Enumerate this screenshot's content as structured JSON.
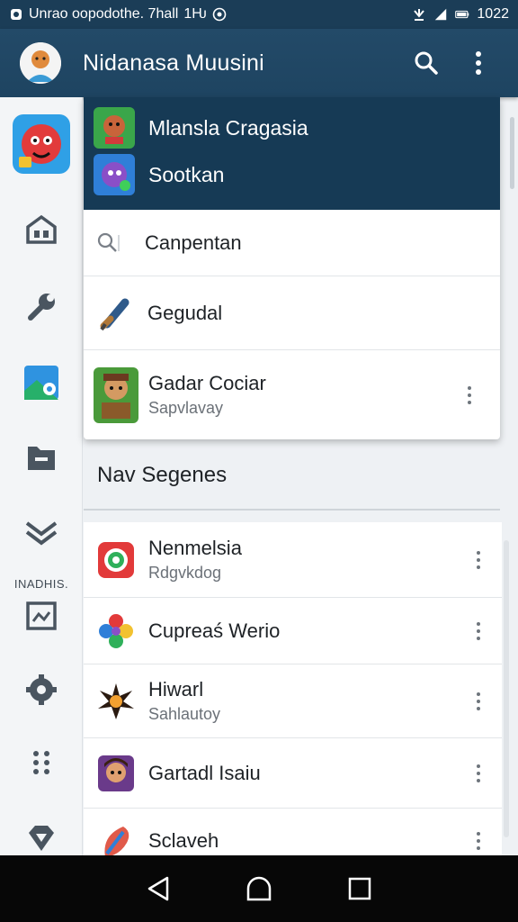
{
  "status": {
    "left_text": "Unrao oopodothe. 7hall",
    "extra": "1Ƕ",
    "time": "1022"
  },
  "appbar": {
    "title": "Nidanasa Muusini"
  },
  "rail": {
    "label": "INADHIS."
  },
  "dropdown": {
    "header_items": [
      "Mlansla Cragasia",
      "Sootkan"
    ],
    "search_text": "Canpentan",
    "row2_text": "Gegudal",
    "row3": {
      "title": "Gadar Cociar",
      "subtitle": "Sapvlavay"
    }
  },
  "section": {
    "title": "Nav Segenes"
  },
  "list": {
    "items": [
      {
        "title": "Nenmelsia",
        "subtitle": "Rdgvkdog"
      },
      {
        "title": "Cupreaś Werio",
        "subtitle": ""
      },
      {
        "title": "Hiwarl",
        "subtitle": "Sahlautoy"
      },
      {
        "title": "Gartadl Isaiu",
        "subtitle": ""
      },
      {
        "title": "Sclaveh",
        "subtitle": ""
      }
    ]
  },
  "colors": {
    "appbar": "#1e4461",
    "status": "#1b3d57",
    "dropdown_header": "#163a55",
    "nav": "#070707"
  }
}
